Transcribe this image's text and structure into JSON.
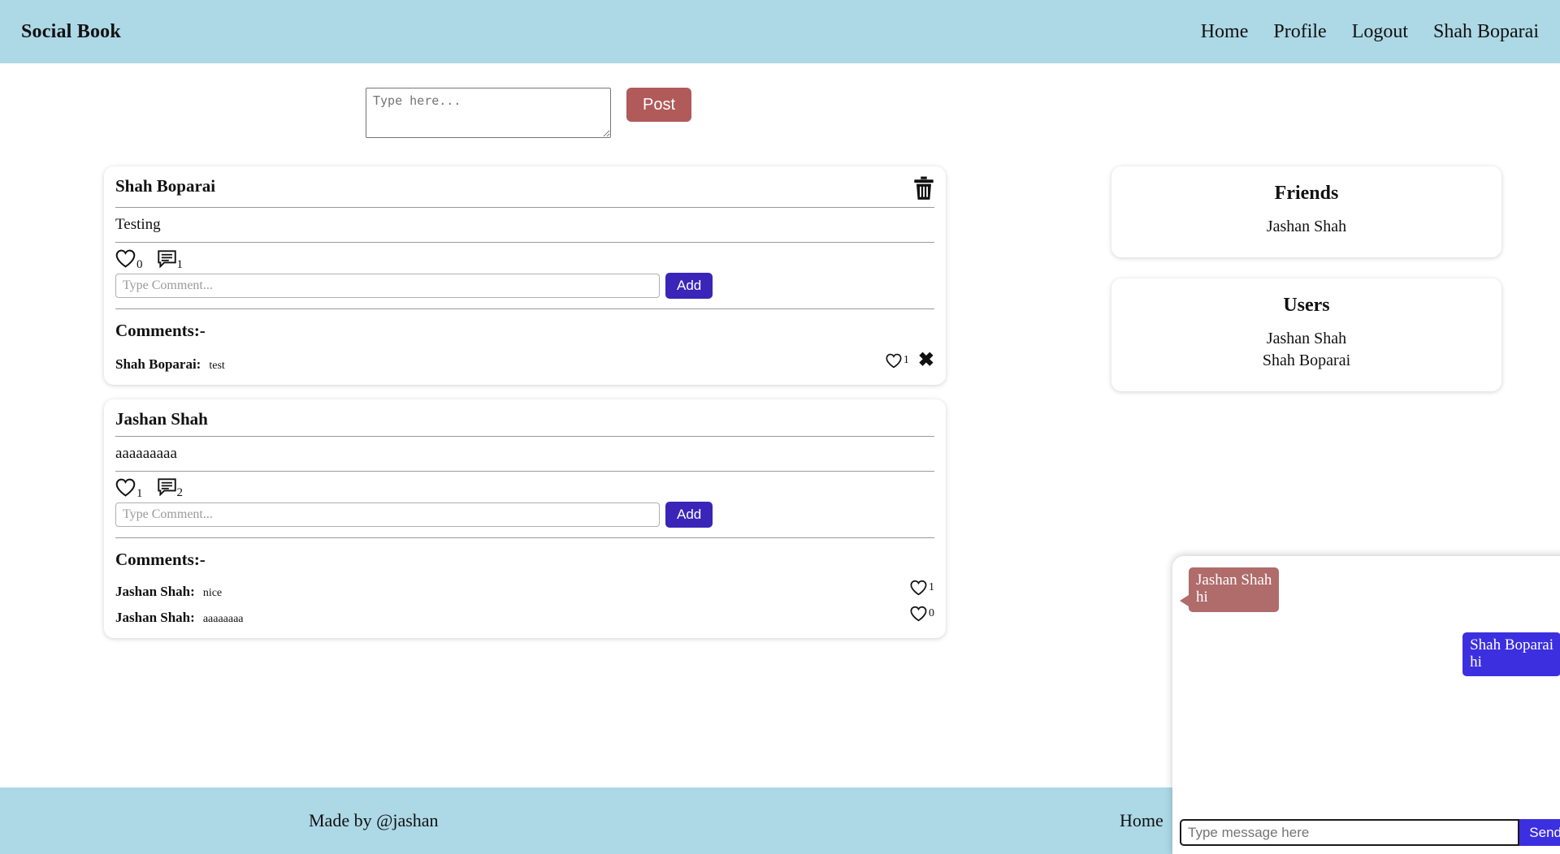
{
  "header": {
    "brand": "Social Book",
    "nav": [
      {
        "label": "Home"
      },
      {
        "label": "Profile"
      },
      {
        "label": "Logout"
      },
      {
        "label": "Shah Boparai"
      }
    ]
  },
  "composer": {
    "placeholder": "Type here...",
    "value": "",
    "post_label": "Post"
  },
  "feed": {
    "comment_placeholder": "Type Comment...",
    "add_label": "Add",
    "comments_heading": "Comments:-",
    "posts": [
      {
        "author": "Shah Boparai",
        "text": "Testing",
        "likes": "0",
        "comment_count": "1",
        "has_delete": true,
        "comments": [
          {
            "user": "Shah Boparai:",
            "text": "test",
            "likes": "1",
            "has_delete": true
          }
        ]
      },
      {
        "author": "Jashan Shah",
        "text": "aaaaaaaaa",
        "likes": "1",
        "comment_count": "2",
        "has_delete": false,
        "comments": [
          {
            "user": "Jashan Shah:",
            "text": "nice",
            "likes": "1",
            "has_delete": false
          },
          {
            "user": "Jashan Shah:",
            "text": "aaaaaaaa",
            "likes": "0",
            "has_delete": false
          }
        ]
      }
    ]
  },
  "sidebar": {
    "friends": {
      "title": "Friends",
      "items": [
        "Jashan Shah"
      ]
    },
    "users": {
      "title": "Users",
      "items": [
        "Jashan Shah",
        "Shah Boparai"
      ]
    }
  },
  "chat": {
    "messages": [
      {
        "side": "left",
        "who": "Jashan Shah",
        "msg": "hi"
      },
      {
        "side": "right",
        "who": "Shah Boparai",
        "msg": "hi"
      }
    ],
    "input_placeholder": "Type message here",
    "input_value": "",
    "send_label": "Send"
  },
  "footer": {
    "left": "Made by @jashan",
    "right": "Home"
  },
  "colors": {
    "header_bg": "#add8e6",
    "post_button": "#b05a5a",
    "add_button": "#3a25b8",
    "send_button": "#3c2fe0",
    "bubble_left": "#b06b6b",
    "bubble_right": "#3c2fe0"
  }
}
